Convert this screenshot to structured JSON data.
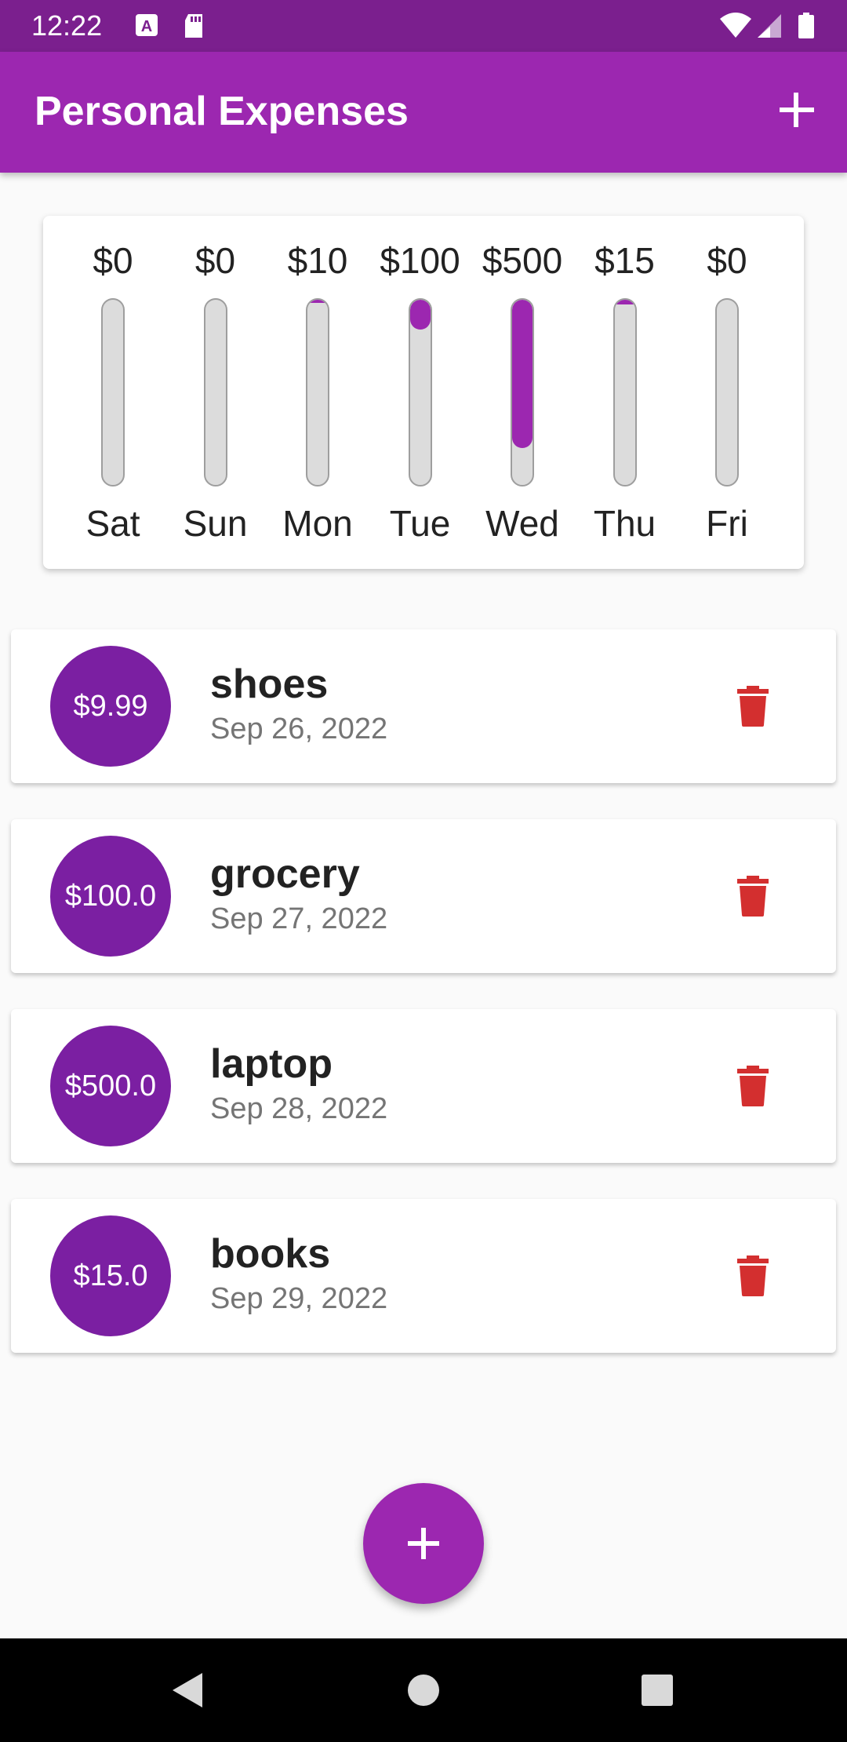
{
  "status_bar": {
    "time": "12:22",
    "icons": [
      "text-a-icon",
      "sd-card-icon",
      "wifi-icon",
      "signal-icon",
      "battery-icon"
    ]
  },
  "app_bar": {
    "title": "Personal Expenses",
    "action_icon": "plus-icon"
  },
  "colors": {
    "primary": "#9c27b0",
    "primary_dark": "#7b1f8e",
    "avatar": "#7b1fa2",
    "delete": "#d32f2f",
    "bar_empty": "#dcdcdc"
  },
  "chart_data": {
    "type": "bar",
    "categories": [
      "Sat",
      "Sun",
      "Mon",
      "Tue",
      "Wed",
      "Thu",
      "Fri"
    ],
    "values": [
      0,
      0,
      10,
      100,
      500,
      15,
      0
    ],
    "labels": [
      "$0",
      "$0",
      "$10",
      "$100",
      "$500",
      "$15",
      "$0"
    ],
    "fill_fraction": [
      0,
      0,
      0.016,
      0.16,
      0.8,
      0.024,
      0
    ]
  },
  "transactions": [
    {
      "amount": "$9.99",
      "title": "shoes",
      "date": "Sep 26, 2022"
    },
    {
      "amount": "$100.0",
      "title": "grocery",
      "date": "Sep 27, 2022"
    },
    {
      "amount": "$500.0",
      "title": "laptop",
      "date": "Sep 28, 2022"
    },
    {
      "amount": "$15.0",
      "title": "books",
      "date": "Sep 29, 2022"
    }
  ],
  "fab": {
    "icon": "plus-icon"
  },
  "nav_bar": {
    "icons": [
      "back-icon",
      "home-icon",
      "recents-icon"
    ]
  }
}
